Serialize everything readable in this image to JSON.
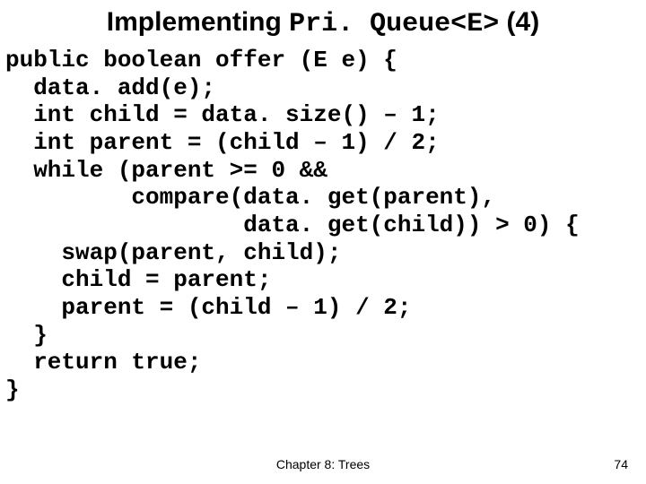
{
  "title": {
    "part1": "Implementing ",
    "mono": "Pri. Queue<E>",
    "part2": " (4)"
  },
  "code": {
    "l01": "public boolean offer (E e) {",
    "l02": "  data. add(e);",
    "l03": "  int child = data. size() – 1;",
    "l04": "  int parent = (child – 1) / 2;",
    "l05": "  while (parent >= 0 &&",
    "l06": "         compare(data. get(parent),",
    "l07": "                 data. get(child)) > 0) {",
    "l08": "    swap(parent, child);",
    "l09": "    child = parent;",
    "l10": "    parent = (child – 1) / 2;",
    "l11": "  }",
    "l12": "  return true;",
    "l13": "}"
  },
  "footer": {
    "chapter": "Chapter 8: Trees",
    "page": "74"
  }
}
